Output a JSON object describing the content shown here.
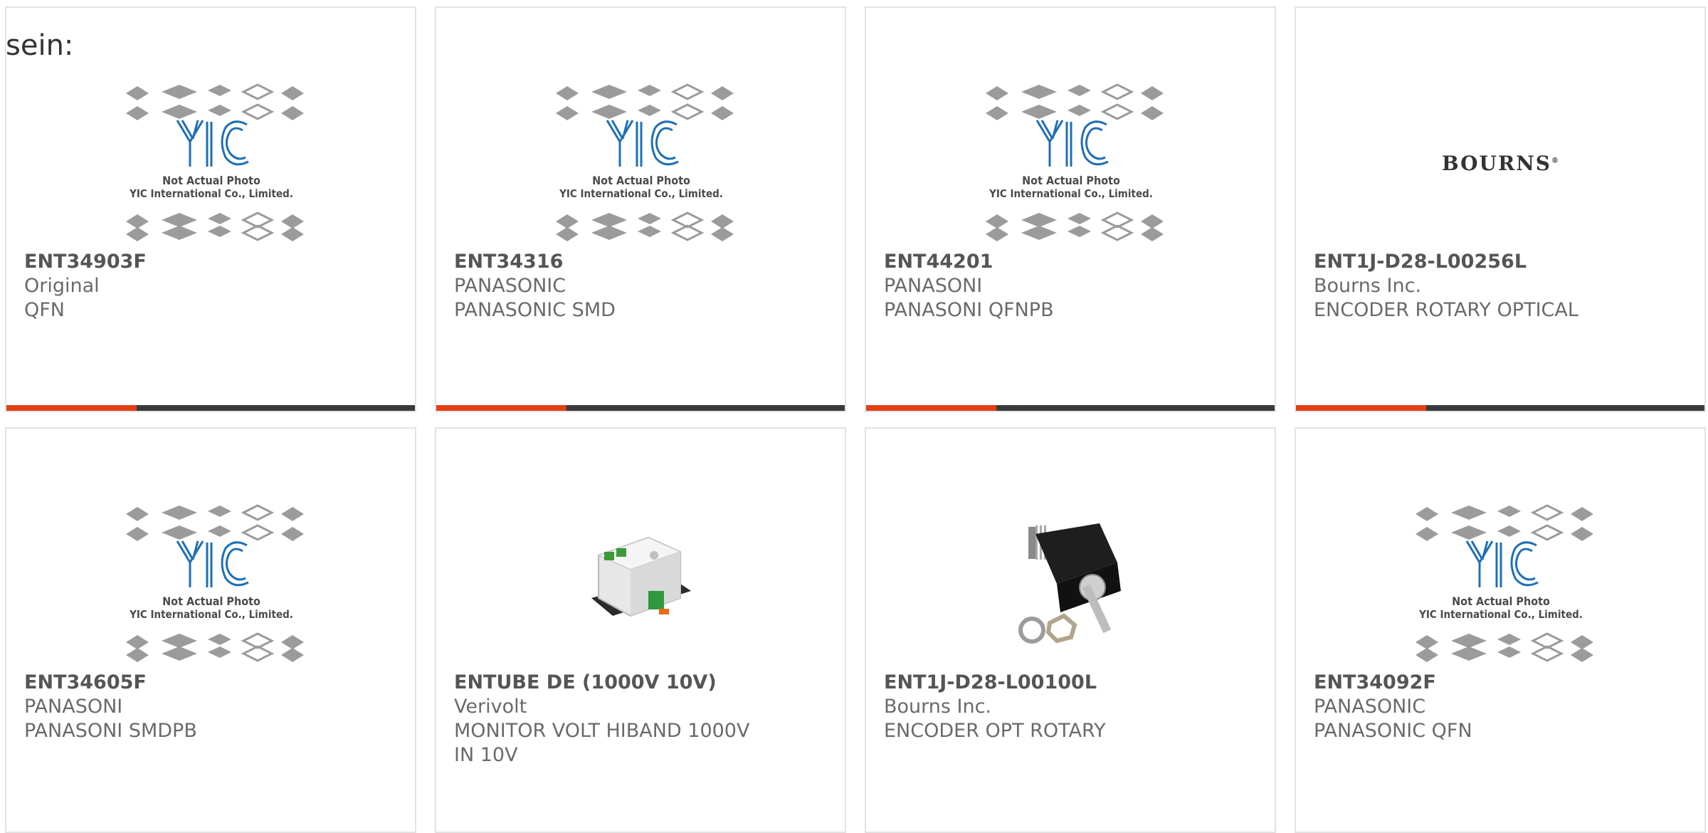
{
  "prefix_text": "sein:",
  "products": [
    {
      "part": "ENT34903F",
      "maker": "Original",
      "desc": "QFN",
      "image": "yic-placeholder"
    },
    {
      "part": "ENT34316",
      "maker": "PANASONIC",
      "desc": "PANASONIC SMD",
      "image": "yic-placeholder"
    },
    {
      "part": "ENT44201",
      "maker": "PANASONI",
      "desc": "PANASONI QFNPB",
      "image": "yic-placeholder"
    },
    {
      "part": "ENT1J-D28-L00256L",
      "maker": "Bourns Inc.",
      "desc": "ENCODER ROTARY OPTICAL",
      "image": "bourns-logo"
    },
    {
      "part": "ENT34605F",
      "maker": "PANASONI",
      "desc": "PANASONI SMDPB",
      "image": "yic-placeholder"
    },
    {
      "part": "ENTUBE DE (1000V 10V)",
      "maker": "Verivolt",
      "desc": "MONITOR VOLT HIBAND 1000V IN 10V",
      "image": "din-rail-module"
    },
    {
      "part": "ENT1J-D28-L00100L",
      "maker": "Bourns Inc.",
      "desc": "ENCODER OPT ROTARY",
      "image": "rotary-encoder"
    },
    {
      "part": "ENT34092F",
      "maker": "PANASONIC",
      "desc": "PANASONIC QFN",
      "image": "yic-placeholder"
    }
  ],
  "placeholder": {
    "line1": "Not Actual Photo",
    "line2": "YIC International Co., Limited.",
    "logo": "YIC"
  },
  "bourns_logo": "BOURNS",
  "colors": {
    "accent": "#e23f15",
    "bar": "#3a3a3a",
    "yic_blue": "#1f6fb5"
  }
}
